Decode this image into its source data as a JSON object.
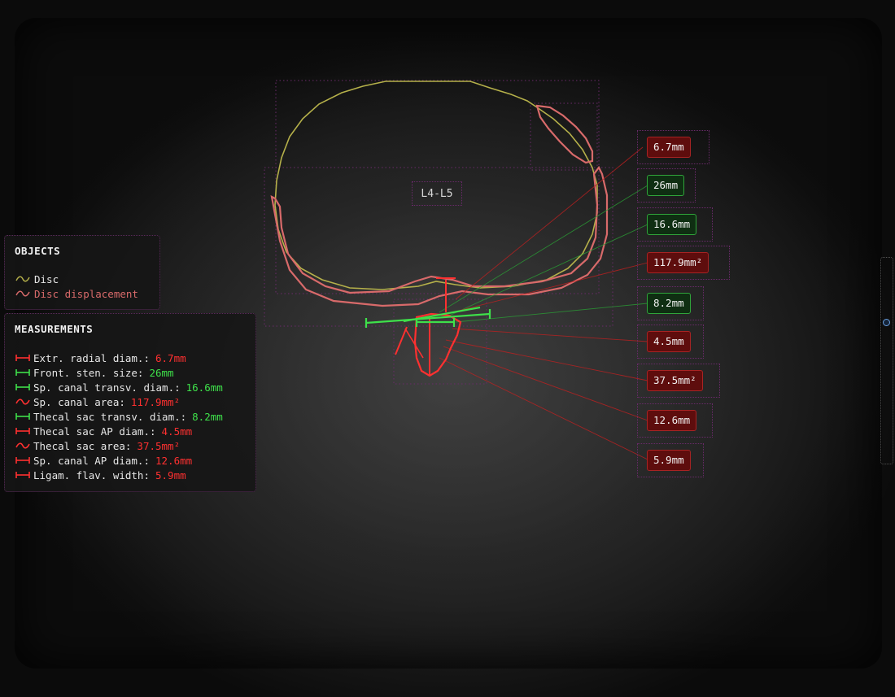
{
  "level_label": "L4-L5",
  "objects": {
    "title": "OBJECTS",
    "items": [
      {
        "label": "Disc",
        "color": "#b5b04a",
        "icon": "wave-icon"
      },
      {
        "label": "Disc displacement",
        "color": "#d86a6a",
        "icon": "wave-icon"
      }
    ]
  },
  "measurements": {
    "title": "MEASUREMENTS",
    "items": [
      {
        "label": "Extr. radial diam.:",
        "value": "6.7mm",
        "color": "#ff3030",
        "icon": "ruler-icon"
      },
      {
        "label": "Front. sten. size:",
        "value": "26mm",
        "color": "#3ee04a",
        "icon": "ruler-icon"
      },
      {
        "label": "Sp. canal transv. diam.:",
        "value": "16.6mm",
        "color": "#3ee04a",
        "icon": "ruler-icon"
      },
      {
        "label": "Sp. canal area:",
        "value": "117.9mm²",
        "color": "#ff3030",
        "icon": "area-icon"
      },
      {
        "label": "Thecal sac transv. diam.:",
        "value": "8.2mm",
        "color": "#3ee04a",
        "icon": "ruler-icon"
      },
      {
        "label": "Thecal sac AP diam.:",
        "value": "4.5mm",
        "color": "#ff3030",
        "icon": "ruler-icon"
      },
      {
        "label": "Thecal sac area:",
        "value": "37.5mm²",
        "color": "#ff3030",
        "icon": "area-icon"
      },
      {
        "label": "Sp. canal AP diam.:",
        "value": "12.6mm",
        "color": "#ff3030",
        "icon": "ruler-icon"
      },
      {
        "label": "Ligam. flav. width:",
        "value": "5.9mm",
        "color": "#ff3030",
        "icon": "ruler-icon"
      }
    ]
  },
  "tags": [
    {
      "value": "6.7mm",
      "kind": "red"
    },
    {
      "value": "26mm",
      "kind": "green"
    },
    {
      "value": "16.6mm",
      "kind": "green"
    },
    {
      "value": "117.9mm²",
      "kind": "red"
    },
    {
      "value": "8.2mm",
      "kind": "green"
    },
    {
      "value": "4.5mm",
      "kind": "red"
    },
    {
      "value": "37.5mm²",
      "kind": "red"
    },
    {
      "value": "12.6mm",
      "kind": "red"
    },
    {
      "value": "5.9mm",
      "kind": "red"
    }
  ],
  "colors": {
    "disc": "#b5b04a",
    "disc_displacement": "#d86a6a",
    "measure_red": "#ff3030",
    "measure_green": "#3ee04a"
  }
}
